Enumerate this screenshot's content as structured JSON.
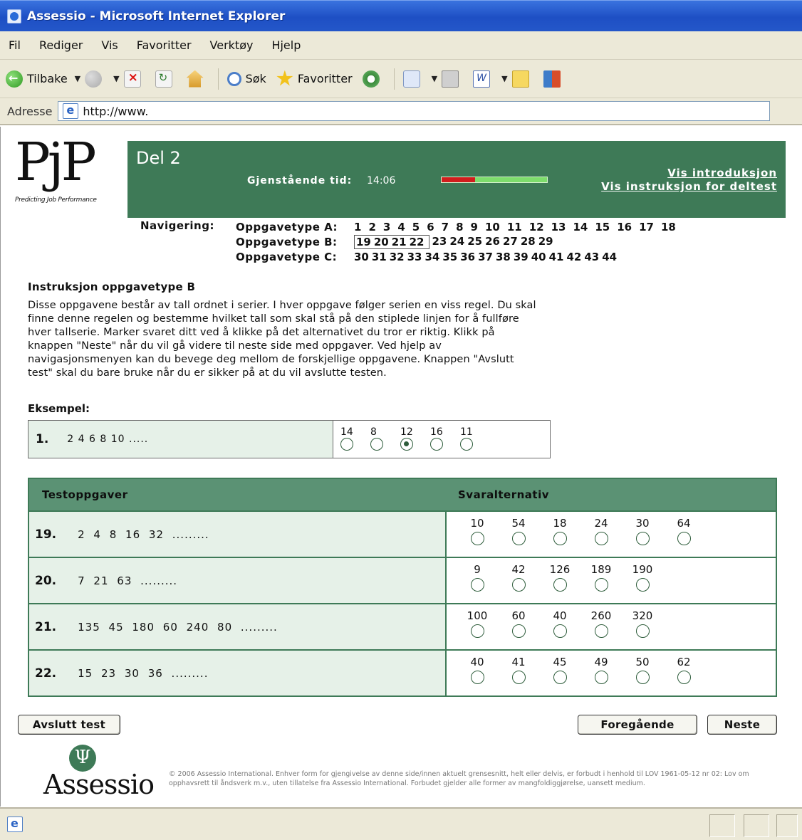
{
  "window": {
    "title": "Assessio - Microsoft Internet Explorer"
  },
  "menu": [
    "Fil",
    "Rediger",
    "Vis",
    "Favoritter",
    "Verktøy",
    "Hjelp"
  ],
  "toolbar": {
    "back_label": "Tilbake",
    "search_label": "Søk",
    "favorites_label": "Favoritter"
  },
  "address": {
    "label": "Adresse",
    "url": "http://www."
  },
  "logo": {
    "mark": "PjP",
    "tagline": "Predicting Job Performance"
  },
  "header": {
    "section": "Del 2",
    "time_label": "Gjenstående tid:",
    "time_value": "14:06",
    "time_used_fraction": 0.32,
    "link_intro": "Vis introduksjon",
    "link_instructions": "Vis instruksjon for deltest"
  },
  "navigation": {
    "label": "Navigering:",
    "rows": [
      {
        "label": "Oppgavetype A:",
        "items": [
          "1",
          "2",
          "3",
          "4",
          "5",
          "6",
          "7",
          "8",
          "9",
          "10",
          "11",
          "12",
          "13",
          "14",
          "15",
          "16",
          "17",
          "18"
        ]
      },
      {
        "label": "Oppgavetype B:",
        "items": [
          "19",
          "20",
          "21",
          "22",
          "23",
          "24",
          "25",
          "26",
          "27",
          "28",
          "29"
        ],
        "current": [
          "19",
          "20",
          "21",
          "22"
        ]
      },
      {
        "label": "Oppgavetype C:",
        "items": [
          "30",
          "31",
          "32",
          "33",
          "34",
          "35",
          "36",
          "37",
          "38",
          "39",
          "40",
          "41",
          "42",
          "43",
          "44"
        ]
      }
    ]
  },
  "instructions": {
    "heading": "Instruksjon oppgavetype B",
    "text": "Disse oppgavene består av tall ordnet i serier. I hver oppgave følger serien en viss regel. Du skal finne denne regelen og bestemme hvilket tall som skal stå på den stiplede linjen for å fullføre hver tallserie. Marker svaret ditt ved å klikke på det alternativet du tror er riktig. Klikk på knappen \"Neste\" når du vil gå videre til neste side med oppgaver. Ved hjelp av navigasjonsmenyen kan du bevege deg mellom de forskjellige oppgavene. Knappen \"Avslutt test\" skal du bare bruke når du er sikker på at du vil avslutte testen."
  },
  "example": {
    "label": "Eksempel:",
    "number": "1.",
    "series": "2  4  6  8  10  .....",
    "options": [
      "14",
      "8",
      "12",
      "16",
      "11"
    ],
    "selected_index": 2
  },
  "tests": {
    "col_tasks": "Testoppgaver",
    "col_options": "Svaralternativ",
    "rows": [
      {
        "number": "19.",
        "series": "2  4  8  16  32  .........",
        "options": [
          "10",
          "54",
          "18",
          "24",
          "30",
          "64"
        ]
      },
      {
        "number": "20.",
        "series": "7  21  63  .........",
        "options": [
          "9",
          "42",
          "126",
          "189",
          "190"
        ]
      },
      {
        "number": "21.",
        "series": "135  45  180  60  240  80  .........",
        "options": [
          "100",
          "60",
          "40",
          "260",
          "320"
        ]
      },
      {
        "number": "22.",
        "series": "15  23  30  36  .........",
        "options": [
          "40",
          "41",
          "45",
          "49",
          "50",
          "62"
        ]
      }
    ]
  },
  "buttons": {
    "finish": "Avslutt test",
    "previous": "Foregående",
    "next": "Neste"
  },
  "footer": {
    "logo_word": "Assessio",
    "logo_symbol": "Ψ",
    "copyright": "© 2006 Assessio International. Enhver form for gjengivelse av denne side/innen aktuelt grensesnitt, helt eller delvis, er forbudt i henhold til LOV 1961-05-12 nr 02: Lov om opphavsrett til åndsverk m.v., uten tillatelse fra Assessio International. Forbudet gjelder alle former av mangfoldiggjørelse, uansett medium."
  }
}
